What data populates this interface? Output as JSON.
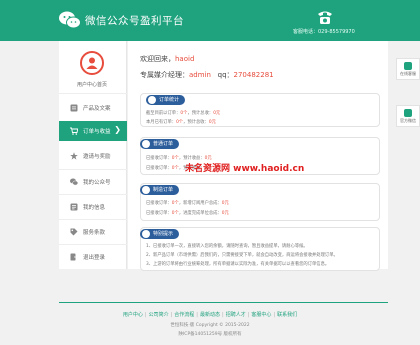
{
  "header": {
    "title": "微信公众号盈利平台",
    "phone": "客服电话：029-85579970"
  },
  "sidebar": {
    "user_home": "用户中心首页",
    "items": [
      {
        "label": "产品及文案"
      },
      {
        "label": "订单与收益",
        "chevron": "❯"
      },
      {
        "label": "邀请与奖励"
      },
      {
        "label": "我的公众号"
      },
      {
        "label": "我的信息"
      },
      {
        "label": "服务条款"
      },
      {
        "label": "退出登录"
      }
    ]
  },
  "main": {
    "welcome_prefix": "欢迎回来，",
    "welcome_user": "haoid",
    "manager_prefix": "专属媒介经理：",
    "manager_name": "admin",
    "qq_prefix": "qq：",
    "qq_number": "270482281",
    "boxes": [
      {
        "tag": "订单统计",
        "lines": [
          {
            "text": "截至目前以订单：",
            "num": "0个",
            "text2": "，预计总收：",
            "num2": "0元"
          },
          {
            "text": "本月已有订单：",
            "num": "0个",
            "text2": "，预计总收：",
            "num2": "0元"
          }
        ]
      },
      {
        "tag": "普通订单",
        "lines": [
          {
            "text": "已接收订单：",
            "num": "0个",
            "text2": "，预计收益：",
            "num2": "0元"
          },
          {
            "text": "已接收订单：",
            "num": "0个",
            "text2": "，预计收益：",
            "num2": "0元"
          }
        ]
      },
      {
        "tag": "制造订单",
        "lines": [
          {
            "text": "已接收订单：",
            "num": "0个",
            "text2": "，新增订阅用户总成：",
            "num2": "0元"
          },
          {
            "text": "已接收订单：",
            "num": "0个",
            "text2": "，进度完成单位总成：",
            "num2": "0元"
          }
        ]
      },
      {
        "tag": "特别提示",
        "lines": [
          {
            "text": "1、已接收订单一次，直接转入您的余额，请随时查询，暂且收益提单，请耐心等候。"
          },
          {
            "text": "2、新产品订单（市场供需）后我们的，只需要接受下单，就会自动改变，商运将会接收并处理订单。"
          },
          {
            "text": "3、上游的订单将由行业统筹处理，所有单据请以实际为准，有关单据可以以查看您的订单信息。"
          }
        ]
      }
    ],
    "watermark": "未名资源网 www.haoid.cn"
  },
  "right_tabs": [
    {
      "label": "在线客服"
    },
    {
      "label": "官方微信"
    }
  ],
  "footer": {
    "links": [
      "用户中心",
      "公司简介",
      "合作流程",
      "最新动态",
      "招聘人才",
      "客服中心",
      "联系我们"
    ],
    "copyright": "世恒科技·版 Copyright © 2015-2022",
    "icp": "陕ICP备14051259号 版权所有"
  },
  "colors": {
    "brand_green": "#1fa27e",
    "tag_blue": "#2d5e9c",
    "highlight_red": "#e74c3c"
  }
}
